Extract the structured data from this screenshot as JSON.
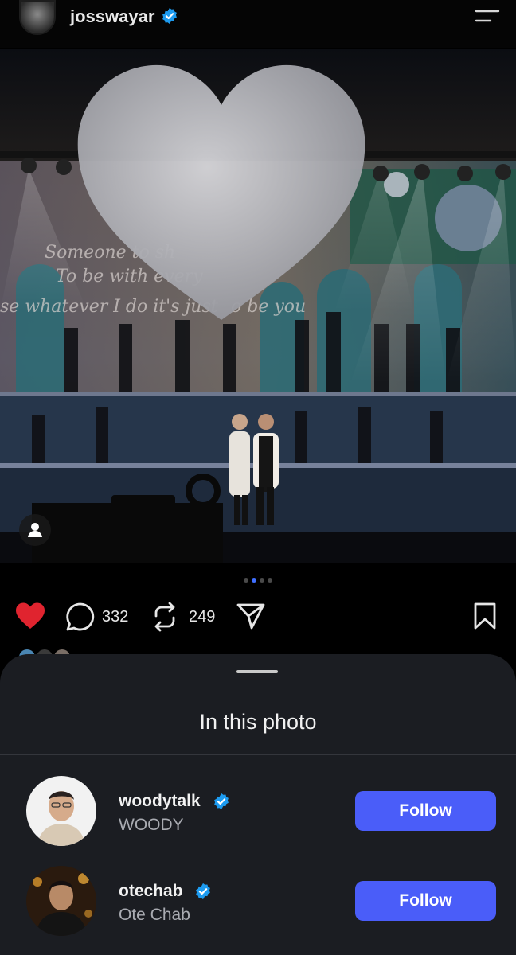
{
  "header": {
    "username": "josswayar",
    "avatar_icon": "profile-avatar",
    "menu_icon": "hamburger-menu-icon"
  },
  "carousel": {
    "total": 4,
    "active_index": 1
  },
  "actions": {
    "liked": true,
    "comment_count": "332",
    "repost_count": "249"
  },
  "sheet": {
    "title": "In this photo",
    "people": [
      {
        "username": "woodytalk",
        "display_name": "WOODY",
        "verified": true,
        "button": "Follow"
      },
      {
        "username": "otechab",
        "display_name": "Ote Chab",
        "verified": true,
        "button": "Follow"
      }
    ]
  },
  "colors": {
    "accent": "#4a5df9",
    "like": "#e0242f",
    "verified": "#1d9bf0",
    "sheet_bg": "#1b1d22"
  }
}
